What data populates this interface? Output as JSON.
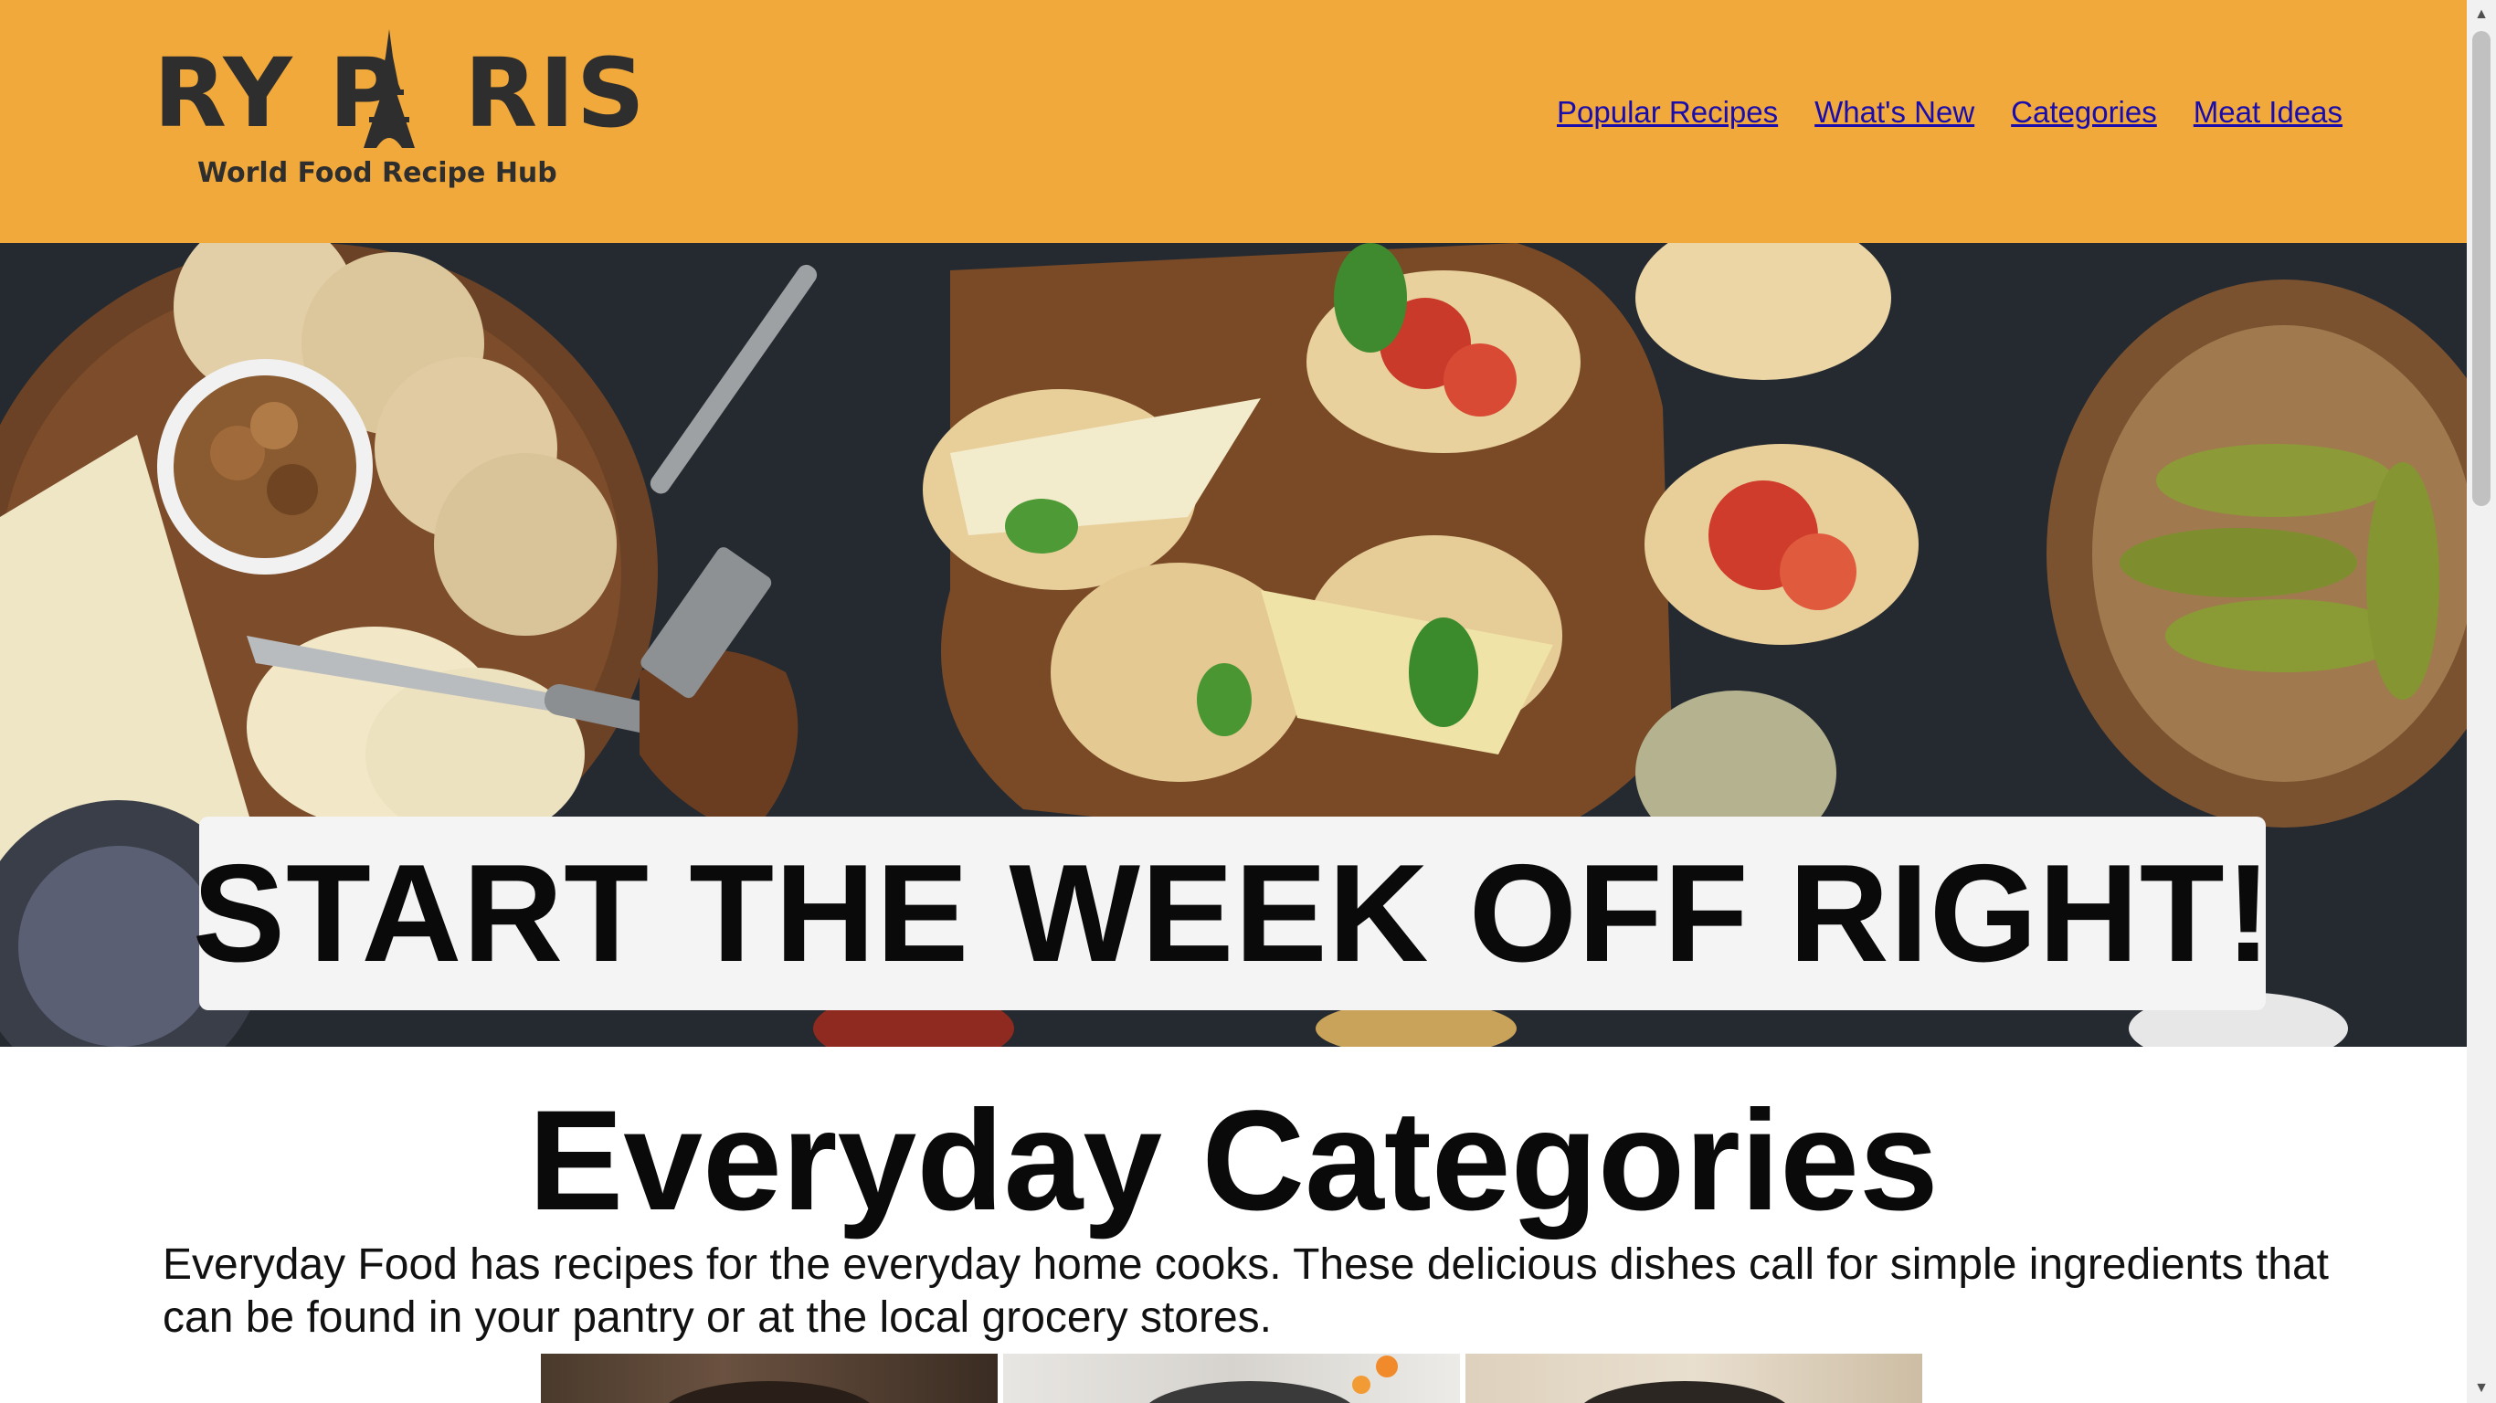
{
  "header": {
    "logo_text_left": "RY P",
    "logo_text_right": "RIS",
    "logo_tagline": "World Food Recipe Hub",
    "nav": [
      {
        "label": "Popular Recipes"
      },
      {
        "label": "What's New"
      },
      {
        "label": "Categories"
      },
      {
        "label": "Meat Ideas"
      }
    ],
    "background_color": "#f2a93b",
    "link_color": "#1a0dab"
  },
  "hero": {
    "banner_text": "START THE WEEK OFF RIGHT!",
    "image_subject": "food-platter-photo"
  },
  "main": {
    "title": "Everyday Categories",
    "intro": "Everyday Food has recipes for the everyday home cooks. These delicious dishes call for simple ingredients that can be found in your pantry or at the local grocery stores."
  },
  "icons": {
    "scroll_up": "▲",
    "scroll_down": "▼"
  }
}
